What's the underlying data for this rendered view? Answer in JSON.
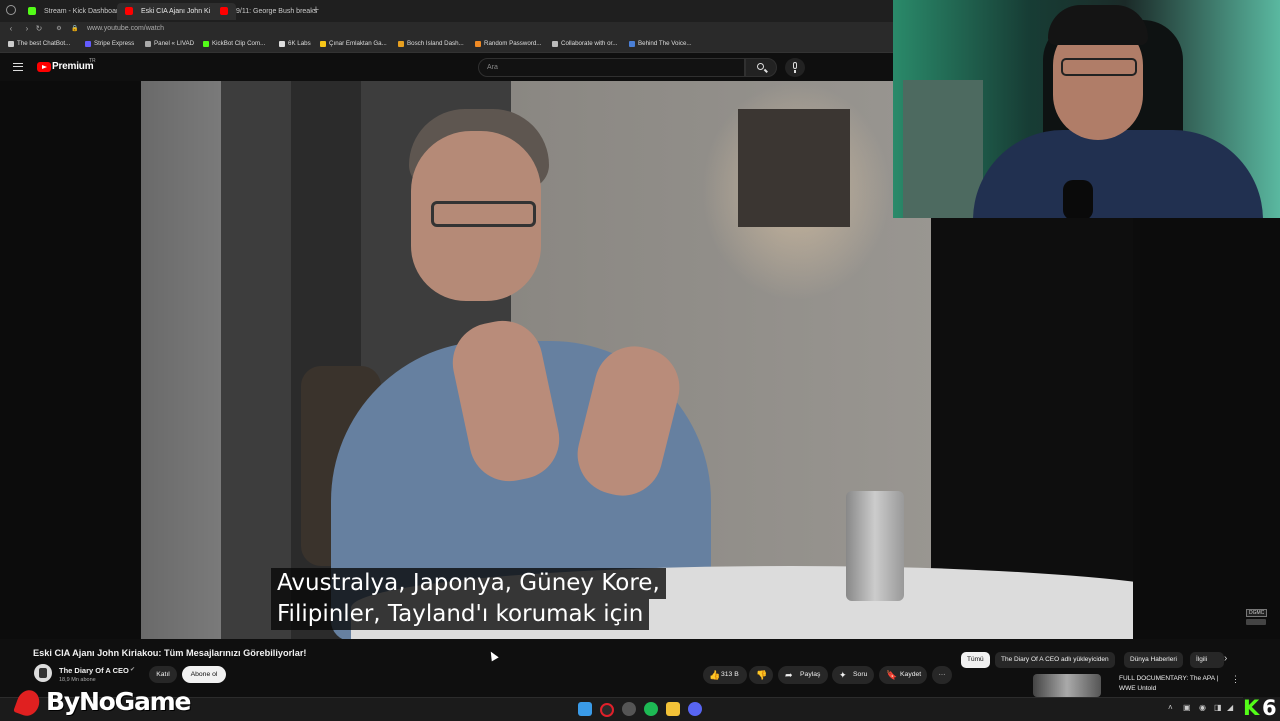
{
  "browser": {
    "tabs": [
      {
        "label": "Stream - Kick Dashboard",
        "color": "#53fc18"
      },
      {
        "label": "Eski CIA Ajanı John Ki",
        "color": "#ff0000"
      },
      {
        "label": "9/11: George Bush breaks",
        "color": "#ff0000"
      }
    ],
    "new_tab": "+",
    "url": "www.youtube.com/watch",
    "bookmarks": [
      {
        "label": "The best ChatBot...",
        "color": "#cccccc"
      },
      {
        "label": "Stripe Express",
        "color": "#635bff"
      },
      {
        "label": "Panel « LIVAD",
        "color": "#aaaaaa"
      },
      {
        "label": "KickBot Clip Com...",
        "color": "#53fc18"
      },
      {
        "label": "6K Labs",
        "color": "#dddddd"
      },
      {
        "label": "Çınar Emlaktan Ga...",
        "color": "#f5c518"
      },
      {
        "label": "Bosch Island Dash...",
        "color": "#e8a020"
      },
      {
        "label": "Random Password...",
        "color": "#f08a24"
      },
      {
        "label": "Collaborate with or...",
        "color": "#bbbbbb"
      },
      {
        "label": "Behind The Voice...",
        "color": "#4a7fd6"
      }
    ]
  },
  "youtube": {
    "logo": "Premium",
    "logo_badge": "TR",
    "search_placeholder": "Ara",
    "video": {
      "subtitle_line1": "Avustralya, Japonya, Güney Kore,",
      "subtitle_line2": "Filipinler, Tayland'ı korumak için",
      "title": "Eski CIA Ajanı John Kiriakou: Tüm Mesajlarınızı Görebiliyorlar!"
    },
    "channel": {
      "name": "The Diary Of A CEO",
      "verified": "✔",
      "subscribers": "18,9 Mn abone",
      "join_label": "Katıl",
      "subscribe_label": "Abone ol"
    },
    "actions": {
      "likes": "313 B",
      "share": "Paylaş",
      "ask": "Soru",
      "save": "Kaydet",
      "more": "···"
    },
    "chips": [
      "Tümü",
      "The Diary Of A CEO adlı yükleyiciden",
      "Dünya Haberleri",
      "İlgili"
    ],
    "recommendation": {
      "title": "FULL DOCUMENTARY: The APA | WWE Untold"
    },
    "dgmc_label": "DGMC"
  },
  "overlay": {
    "brand": "ByNoGame",
    "kick_letter": "K",
    "kick_number": "6"
  },
  "taskbar": {
    "icons": [
      {
        "name": "windows-start-icon",
        "color": "#3a9be8"
      },
      {
        "name": "opera-icon",
        "color": "#e0202a"
      },
      {
        "name": "obs-icon",
        "color": "#555555"
      },
      {
        "name": "spotify-icon",
        "color": "#1db954"
      },
      {
        "name": "file-explorer-icon",
        "color": "#f3c238"
      },
      {
        "name": "discord-icon",
        "color": "#5865f2"
      }
    ]
  }
}
